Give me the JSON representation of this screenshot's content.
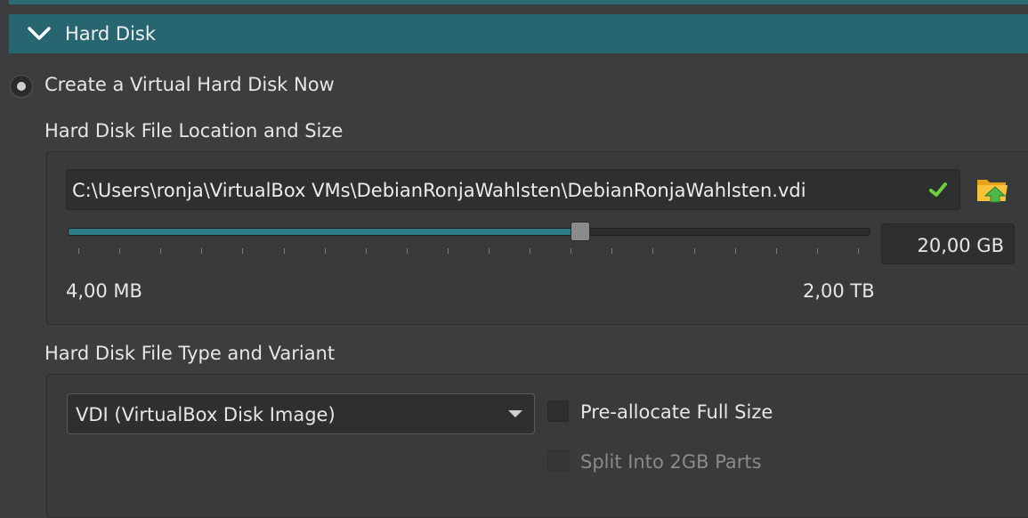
{
  "section": {
    "title": "Hard Disk",
    "expanded": true,
    "accent_color": "#276670"
  },
  "create_option": {
    "label": "Create a Virtual Hard Disk Now",
    "selected": true
  },
  "location_group": {
    "label": "Hard Disk File Location and Size",
    "path": "C:\\Users\\ronja\\VirtualBox VMs\\DebianRonjaWahlsten\\DebianRonjaWahlsten.vdi",
    "path_valid_icon": "check-icon",
    "browse_icon": "folder-icon",
    "size_value": "20,00 GB",
    "slider_fraction": 0.64,
    "tick_count": 20,
    "min_label": "4,00 MB",
    "max_label": "2,00 TB"
  },
  "type_group": {
    "label": "Hard Disk File Type and Variant",
    "format_selected": "VDI (VirtualBox Disk Image)",
    "preallocate_label": "Pre-allocate Full Size",
    "preallocate_checked": false,
    "split_label": "Split Into 2GB Parts",
    "split_checked": false,
    "split_enabled": false
  }
}
